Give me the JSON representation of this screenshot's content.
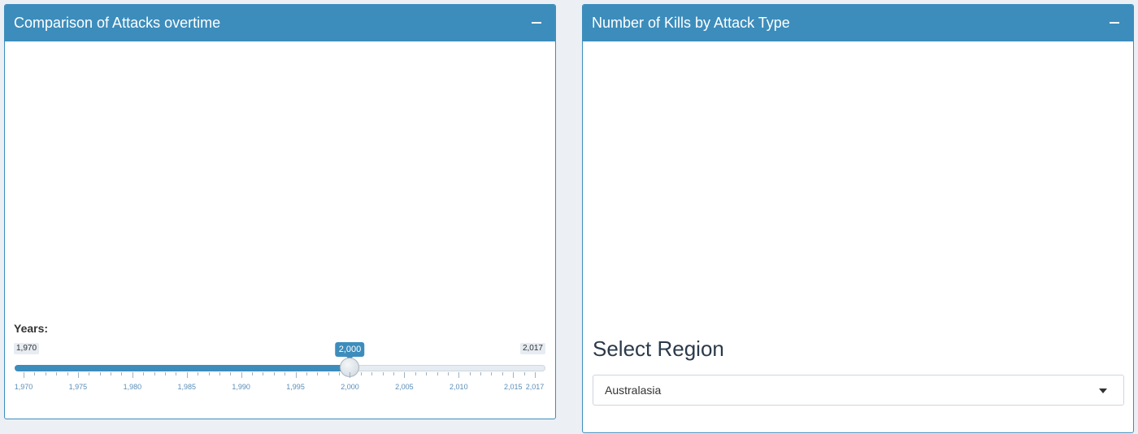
{
  "left_box": {
    "title": "Comparison of Attacks overtime",
    "slider": {
      "label": "Years:",
      "min": 1970,
      "max": 2017,
      "value": 2000,
      "min_label": "1,970",
      "max_label": "2,017",
      "value_label": "2,000",
      "tick_labels": [
        "1,970",
        "1,975",
        "1,980",
        "1,985",
        "1,990",
        "1,995",
        "2,000",
        "2,005",
        "2,010",
        "2,015",
        "2,017"
      ]
    }
  },
  "right_box": {
    "title": "Number of Kills by Attack Type",
    "select": {
      "label": "Select Region",
      "value": "Australasia"
    }
  },
  "colors": {
    "accent": "#3c8dbc",
    "background": "#ecf0f5"
  }
}
